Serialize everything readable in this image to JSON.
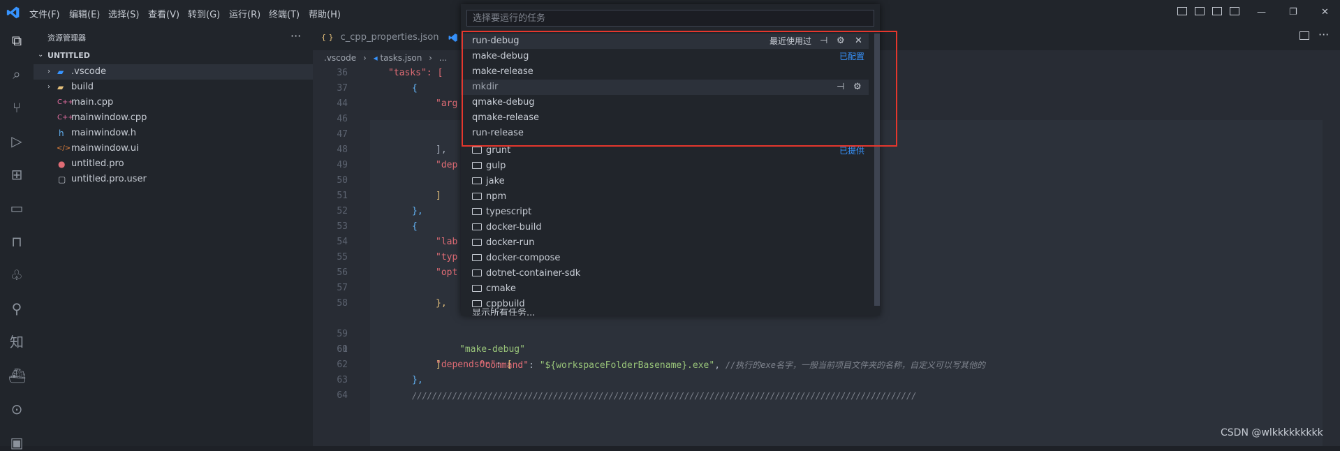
{
  "menu": [
    "文件(F)",
    "编辑(E)",
    "选择(S)",
    "查看(V)",
    "转到(G)",
    "运行(R)",
    "终端(T)",
    "帮助(H)"
  ],
  "window_controls": {
    "minimize": "—",
    "restore": "❐",
    "close": "✕"
  },
  "sidebar": {
    "title": "资源管理器",
    "more": "···",
    "section": "UNTITLED",
    "items": [
      {
        "label": ".vscode",
        "type": "folder",
        "chevron": "›"
      },
      {
        "label": "build",
        "type": "folder",
        "chevron": "›"
      },
      {
        "label": "main.cpp",
        "type": "cpp",
        "icon": "C++"
      },
      {
        "label": "mainwindow.cpp",
        "type": "cpp",
        "icon": "C++"
      },
      {
        "label": "mainwindow.h",
        "type": "h",
        "icon": "h"
      },
      {
        "label": "mainwindow.ui",
        "type": "ui",
        "icon": "</>"
      },
      {
        "label": "untitled.pro",
        "type": "pro",
        "icon": "●"
      },
      {
        "label": "untitled.pro.user",
        "type": "file",
        "icon": "▢"
      }
    ]
  },
  "tabs": [
    {
      "icon": "{ }",
      "label": "c_cpp_properties.json"
    }
  ],
  "breadcrumb": {
    "part1": ".vscode",
    "sep": "›",
    "part2": "tasks.json",
    "part3": "..."
  },
  "code_lines": [
    {
      "n": "36",
      "text": "\"tasks\": ["
    },
    {
      "n": "37",
      "text": "{"
    },
    {
      "n": "44",
      "text": "\"arg"
    },
    {
      "n": "46",
      "text": ""
    },
    {
      "n": "47",
      "text": ""
    },
    {
      "n": "48",
      "text": "],"
    },
    {
      "n": "49",
      "text": "\"dep"
    },
    {
      "n": "50",
      "text": ""
    },
    {
      "n": "51",
      "text": "]"
    },
    {
      "n": "52",
      "text": "},"
    },
    {
      "n": "53",
      "text": "{"
    },
    {
      "n": "54",
      "text": "\"lab"
    },
    {
      "n": "55",
      "text": "\"typ"
    },
    {
      "n": "56",
      "text": "\"opt"
    },
    {
      "n": "57",
      "text": ""
    },
    {
      "n": "58",
      "text": "},"
    },
    {
      "n": "59",
      "key": "\"command\"",
      "colon": ": ",
      "value": "\"${workspaceFolderBasename}.exe\"",
      "comma": ", ",
      "comment": "//执行的exe名字，一般当前项目文件夹的名称，自定义可以写其他的"
    },
    {
      "n": "60",
      "key": "\"dependsOn\"",
      "colon": ": ",
      "value": "[",
      "comma": "",
      "comment": ""
    },
    {
      "n": "61",
      "text": "\"make-debug\""
    },
    {
      "n": "62",
      "text": "]"
    },
    {
      "n": "63",
      "text": "},"
    },
    {
      "n": "64",
      "text": "////////////////////////////////////////////////////////////////////////////////////////////////////"
    }
  ],
  "quickpick": {
    "placeholder": "选择要运行的任务",
    "recent_label": "最近使用过",
    "configured_label": "已配置",
    "provided_label": "已提供",
    "show_all": "显示所有任务...",
    "items": [
      {
        "label": "run-debug",
        "group": "recent"
      },
      {
        "label": "make-debug",
        "group": "configured"
      },
      {
        "label": "make-release",
        "group": "configured"
      },
      {
        "label": "mkdir",
        "group": "configured"
      },
      {
        "label": "qmake-debug",
        "group": "configured"
      },
      {
        "label": "qmake-release",
        "group": "configured"
      },
      {
        "label": "run-release",
        "group": "configured"
      },
      {
        "label": "grunt",
        "group": "provided"
      },
      {
        "label": "gulp",
        "group": "provided"
      },
      {
        "label": "jake",
        "group": "provided"
      },
      {
        "label": "npm",
        "group": "provided"
      },
      {
        "label": "typescript",
        "group": "provided"
      },
      {
        "label": "docker-build",
        "group": "provided"
      },
      {
        "label": "docker-run",
        "group": "provided"
      },
      {
        "label": "docker-compose",
        "group": "provided"
      },
      {
        "label": "dotnet-container-sdk",
        "group": "provided"
      },
      {
        "label": "cmake",
        "group": "provided"
      },
      {
        "label": "cppbuild",
        "group": "provided"
      }
    ]
  },
  "watermark": "CSDN @wlkkkkkkkkk",
  "colors": {
    "accent": "#3794ff",
    "highlight_box": "#e5372d",
    "background": "#282c34"
  }
}
